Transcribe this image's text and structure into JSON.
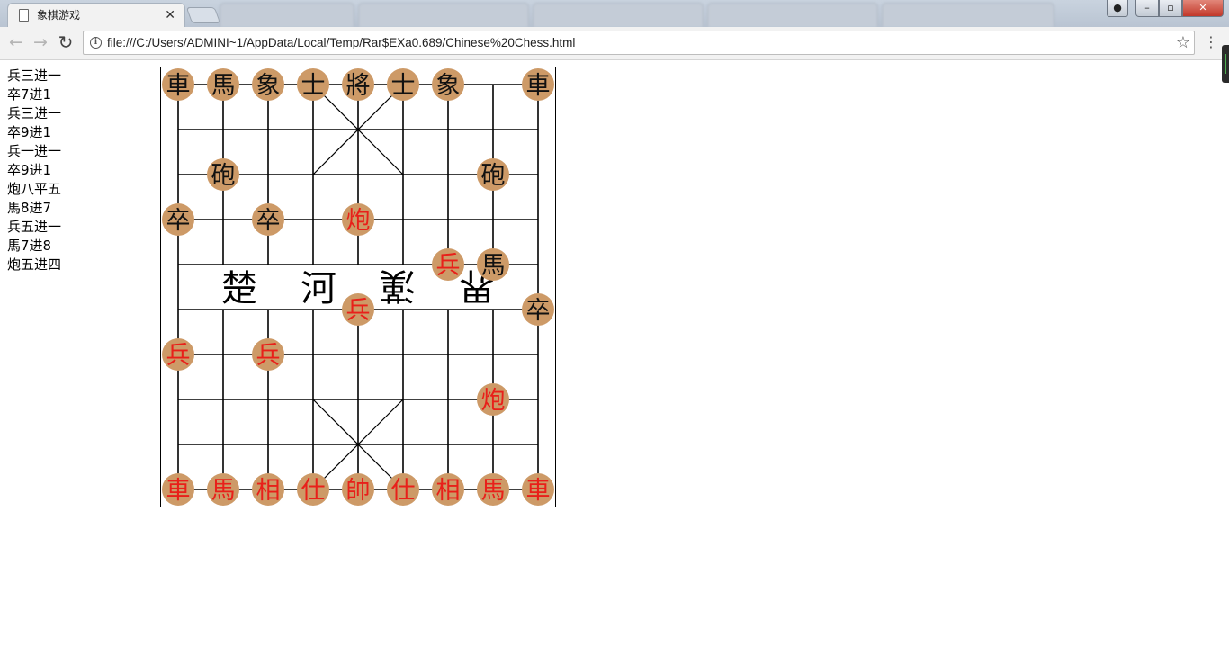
{
  "browser": {
    "active_tab": {
      "title": "象棋游戏",
      "close_glyph": "✕"
    },
    "url": "file:///C:/Users/ADMINI~1/AppData/Local/Temp/Rar$EXa0.689/Chinese%20Chess.html",
    "window_buttons": {
      "minimize": "–",
      "maximize": "▫",
      "close": "✕"
    }
  },
  "moves": [
    "兵三进一",
    "卒7进1",
    "兵三进一",
    "卒9进1",
    "兵一进一",
    "卒9进1",
    "炮八平五",
    "馬8进7",
    "兵五进一",
    "馬7进8",
    "炮五进四"
  ],
  "board": {
    "river_text": [
      "楚",
      "河",
      "漢",
      "界"
    ],
    "colors": {
      "piece_fill": "#cd9a67",
      "red": "#e8201a",
      "black": "#111111",
      "line": "#000000"
    },
    "pieces": [
      {
        "c": 0,
        "r": 0,
        "t": "車",
        "side": "black"
      },
      {
        "c": 1,
        "r": 0,
        "t": "馬",
        "side": "black"
      },
      {
        "c": 2,
        "r": 0,
        "t": "象",
        "side": "black"
      },
      {
        "c": 3,
        "r": 0,
        "t": "士",
        "side": "black"
      },
      {
        "c": 4,
        "r": 0,
        "t": "將",
        "side": "black"
      },
      {
        "c": 5,
        "r": 0,
        "t": "士",
        "side": "black"
      },
      {
        "c": 6,
        "r": 0,
        "t": "象",
        "side": "black"
      },
      {
        "c": 8,
        "r": 0,
        "t": "車",
        "side": "black"
      },
      {
        "c": 1,
        "r": 2,
        "t": "砲",
        "side": "black"
      },
      {
        "c": 7,
        "r": 2,
        "t": "砲",
        "side": "black"
      },
      {
        "c": 0,
        "r": 3,
        "t": "卒",
        "side": "black"
      },
      {
        "c": 2,
        "r": 3,
        "t": "卒",
        "side": "black"
      },
      {
        "c": 4,
        "r": 3,
        "t": "炮",
        "side": "red"
      },
      {
        "c": 6,
        "r": 4,
        "t": "兵",
        "side": "red"
      },
      {
        "c": 7,
        "r": 4,
        "t": "馬",
        "side": "black"
      },
      {
        "c": 4,
        "r": 5,
        "t": "兵",
        "side": "red"
      },
      {
        "c": 8,
        "r": 5,
        "t": "卒",
        "side": "black"
      },
      {
        "c": 0,
        "r": 6,
        "t": "兵",
        "side": "red"
      },
      {
        "c": 2,
        "r": 6,
        "t": "兵",
        "side": "red"
      },
      {
        "c": 7,
        "r": 7,
        "t": "炮",
        "side": "red"
      },
      {
        "c": 0,
        "r": 9,
        "t": "車",
        "side": "red"
      },
      {
        "c": 1,
        "r": 9,
        "t": "馬",
        "side": "red"
      },
      {
        "c": 2,
        "r": 9,
        "t": "相",
        "side": "red"
      },
      {
        "c": 3,
        "r": 9,
        "t": "仕",
        "side": "red"
      },
      {
        "c": 4,
        "r": 9,
        "t": "帥",
        "side": "red"
      },
      {
        "c": 5,
        "r": 9,
        "t": "仕",
        "side": "red"
      },
      {
        "c": 6,
        "r": 9,
        "t": "相",
        "side": "red"
      },
      {
        "c": 7,
        "r": 9,
        "t": "馬",
        "side": "red"
      },
      {
        "c": 8,
        "r": 9,
        "t": "車",
        "side": "red"
      }
    ]
  }
}
